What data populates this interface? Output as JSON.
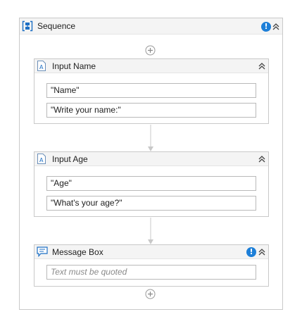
{
  "sequence": {
    "title": "Sequence",
    "icon": "sequence-icon",
    "warning_icon": "!"
  },
  "activities": [
    {
      "title": "Input Name",
      "icon": "input-dialog-icon",
      "fields": [
        "\"Name\"",
        "\"Write your name:\""
      ]
    },
    {
      "title": "Input Age",
      "icon": "input-dialog-icon",
      "fields": [
        "\"Age\"",
        "\"What's your age?\""
      ]
    },
    {
      "title": "Message Box",
      "icon": "message-box-icon",
      "warning_icon": "!",
      "placeholder": "Text must be quoted"
    }
  ],
  "colors": {
    "warning": "#1d7fd8",
    "border": "#c9c9c9",
    "header": "#f4f4f4",
    "connector": "#c8c8c8"
  }
}
